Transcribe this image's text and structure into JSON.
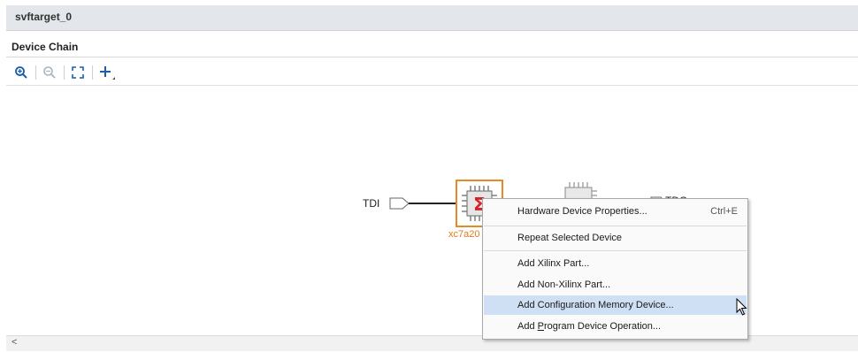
{
  "window": {
    "title": "svftarget_0"
  },
  "section": {
    "title": "Device Chain"
  },
  "toolbar": {
    "buttons": [
      {
        "icon": "zoom-in-icon"
      },
      {
        "icon": "zoom-out-icon"
      },
      {
        "icon": "fit-to-window-icon"
      },
      {
        "icon": "add-icon"
      }
    ]
  },
  "chain": {
    "tdi_label": "TDI",
    "tdo_label": "TDO",
    "device_label": "xc7a20"
  },
  "context_menu": {
    "items": [
      {
        "label": "Hardware Device Properties...",
        "shortcut": "Ctrl+E"
      },
      {
        "label": "Repeat Selected Device"
      },
      {
        "label": "Add Xilinx Part..."
      },
      {
        "label": "Add Non-Xilinx Part..."
      },
      {
        "label": "Add Configuration Memory Device..."
      },
      {
        "label_underline": "P",
        "label_pre": "Add ",
        "label_post": "rogram Device Operation..."
      }
    ]
  },
  "colors": {
    "accent": "#e58a25",
    "highlight": "#cfe0f5"
  }
}
